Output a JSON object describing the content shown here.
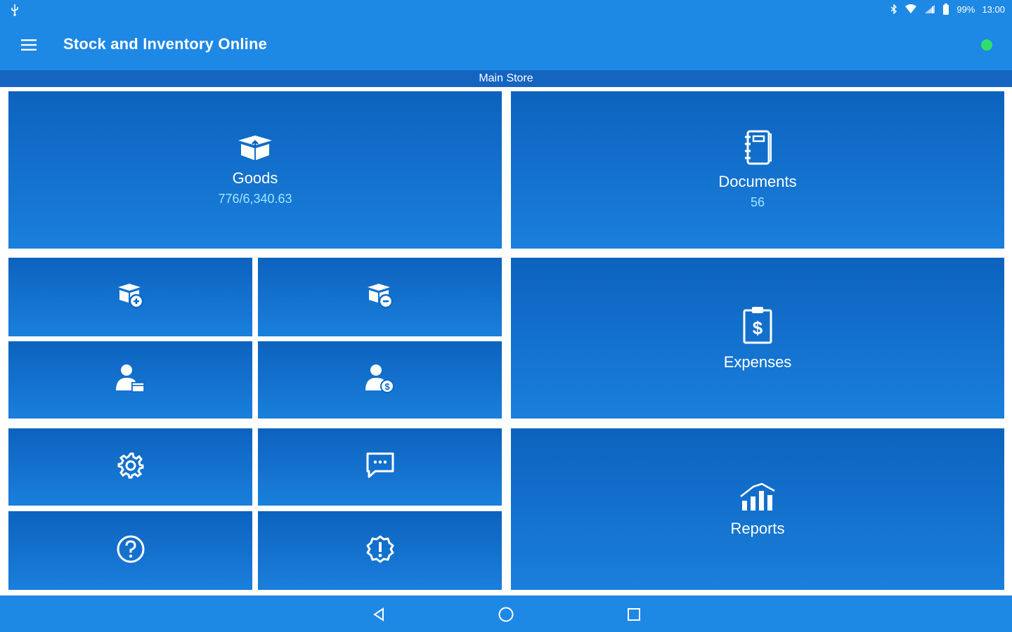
{
  "status_bar": {
    "battery_percent": "99%",
    "time": "13:00",
    "icons": [
      "usb-icon",
      "bluetooth-icon",
      "wifi-icon",
      "signal-icon",
      "battery-icon"
    ]
  },
  "app_bar": {
    "title": "Stock and Inventory Online",
    "menu_icon": "hamburger-menu-icon",
    "status_dot_color": "#2ee06b"
  },
  "store": {
    "name": "Main Store"
  },
  "tiles": {
    "goods": {
      "label": "Goods",
      "value": "776/6,340.63",
      "icon": "box-icon"
    },
    "documents": {
      "label": "Documents",
      "value": "56",
      "icon": "notebook-icon"
    },
    "expenses": {
      "label": "Expenses",
      "icon": "clipboard-dollar-icon"
    },
    "reports": {
      "label": "Reports",
      "icon": "bar-chart-icon"
    },
    "receive_goods": {
      "icon": "box-add-icon"
    },
    "issue_goods": {
      "icon": "box-remove-icon"
    },
    "customer_box": {
      "icon": "user-box-icon"
    },
    "customer_payment": {
      "icon": "user-dollar-icon"
    },
    "settings": {
      "icon": "gear-icon"
    },
    "messages": {
      "icon": "chat-icon"
    },
    "help": {
      "icon": "help-circle-icon"
    },
    "alerts": {
      "icon": "alert-badge-icon"
    }
  },
  "colors": {
    "primary": "#1e88e5",
    "store_bar": "#1565c0",
    "tile_top": "#0c63be",
    "tile_bottom": "#1a7fdc",
    "value_text": "#9fe7ff"
  },
  "nav_bar": {
    "icons": [
      "back-icon",
      "home-icon",
      "recents-icon"
    ]
  }
}
